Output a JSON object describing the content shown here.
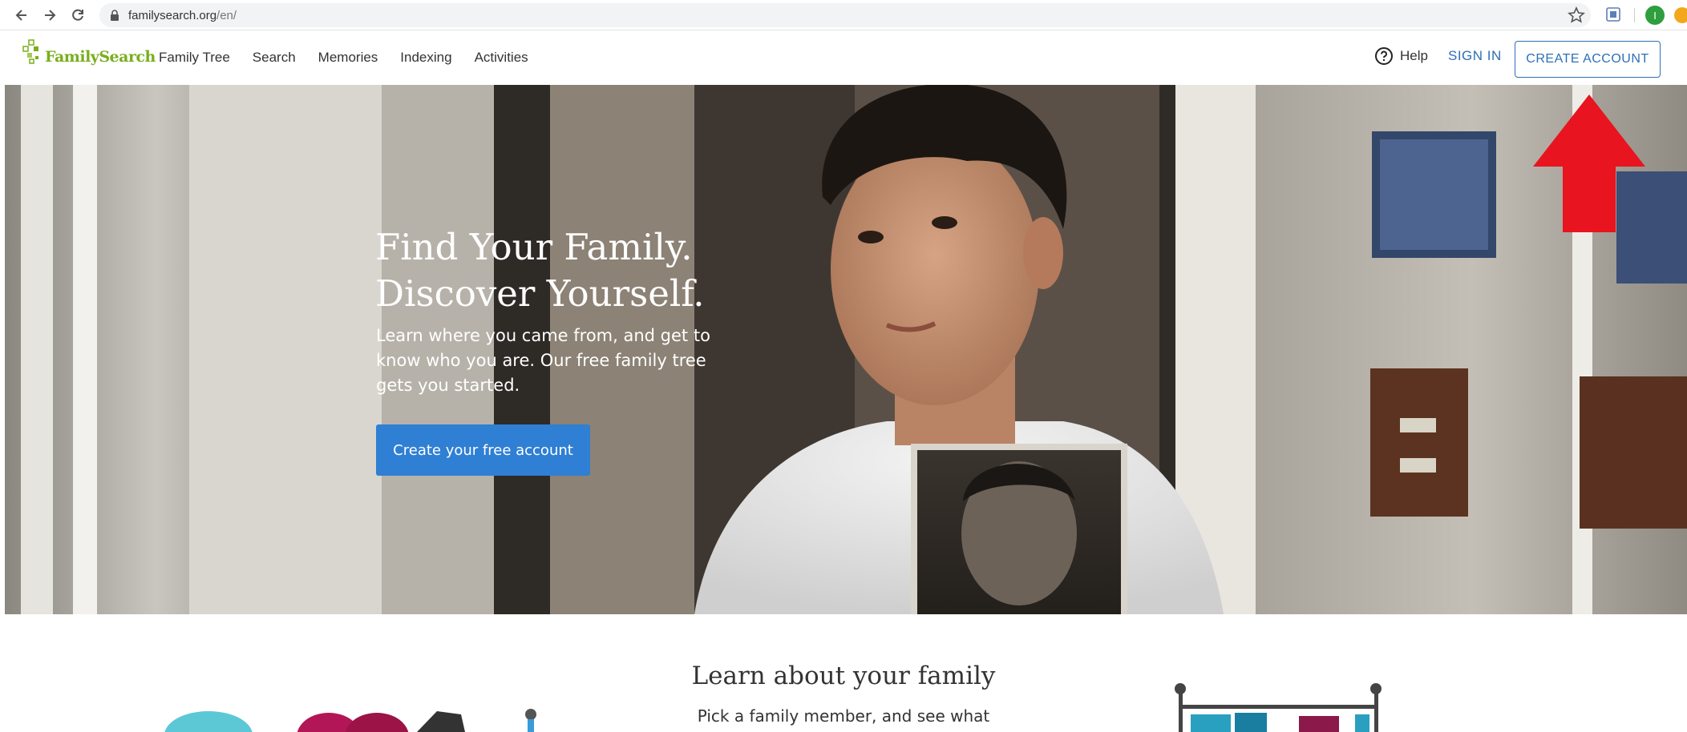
{
  "browser": {
    "url_domain": "familysearch.org",
    "url_path": "/en/",
    "profile_initial": "I"
  },
  "header": {
    "logo_text": "FamilySearch",
    "nav": [
      "Family Tree",
      "Search",
      "Memories",
      "Indexing",
      "Activities"
    ],
    "help_label": "Help",
    "sign_in_label": "SIGN IN",
    "create_account_label": "CREATE ACCOUNT"
  },
  "hero": {
    "title_line1": "Find Your Family.",
    "title_line2": "Discover Yourself.",
    "subtitle": "Learn where you came from, and get to know who you are. Our free family tree gets you started.",
    "cta_label": "Create your free account"
  },
  "learn": {
    "title": "Learn about your family",
    "subtitle": "Pick a family member, and see what"
  },
  "colors": {
    "brand_green": "#7aae1e",
    "link_blue": "#2d6fb7",
    "cta_blue": "#2f7fd4",
    "annotation_red": "#e8141f"
  }
}
